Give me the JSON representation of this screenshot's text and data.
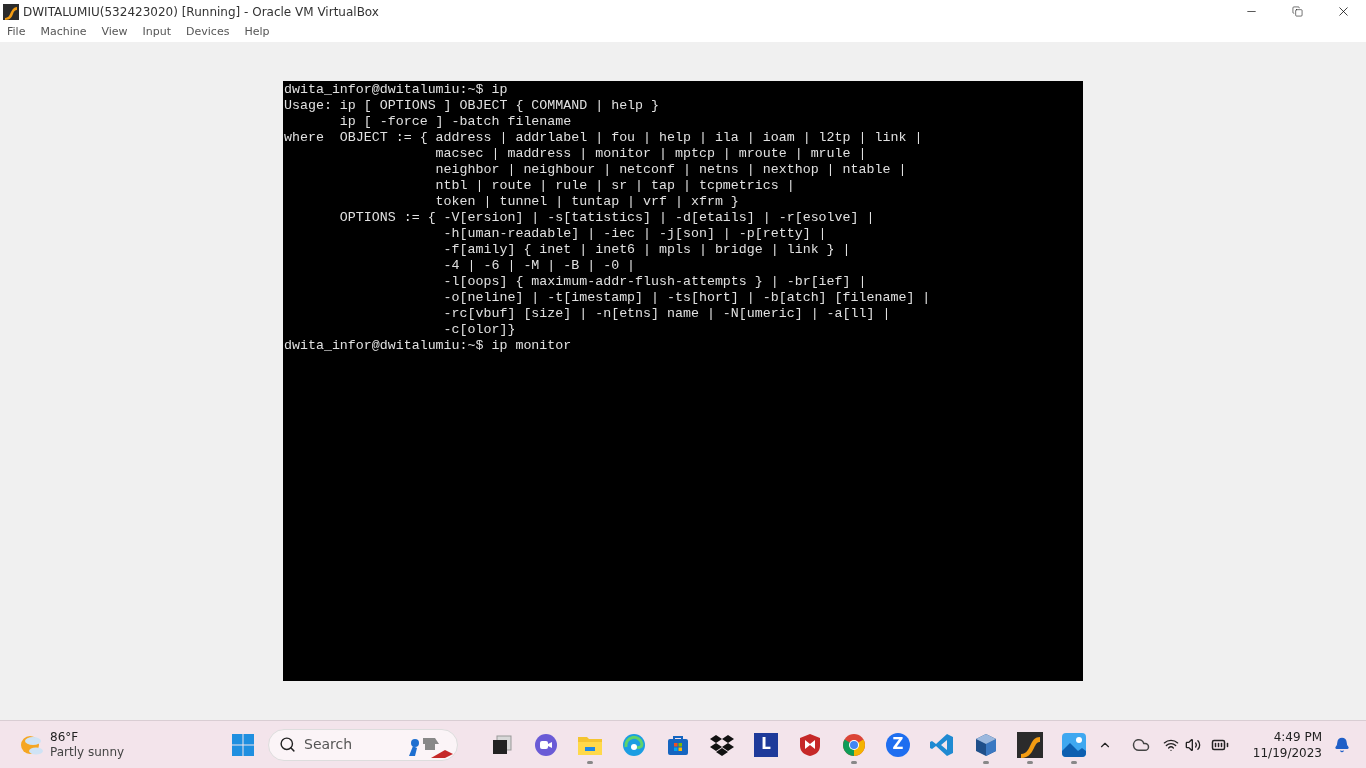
{
  "window": {
    "title": "DWITALUMIU(532423020) [Running] - Oracle VM VirtualBox"
  },
  "menu": [
    "File",
    "Machine",
    "View",
    "Input",
    "Devices",
    "Help"
  ],
  "terminal": {
    "lines": [
      "dwita_infor@dwitalumiu:~$ ip",
      "Usage: ip [ OPTIONS ] OBJECT { COMMAND | help }",
      "       ip [ -force ] -batch filename",
      "where  OBJECT := { address | addrlabel | fou | help | ila | ioam | l2tp | link |",
      "                   macsec | maddress | monitor | mptcp | mroute | mrule |",
      "                   neighbor | neighbour | netconf | netns | nexthop | ntable |",
      "                   ntbl | route | rule | sr | tap | tcpmetrics |",
      "                   token | tunnel | tuntap | vrf | xfrm }",
      "       OPTIONS := { -V[ersion] | -s[tatistics] | -d[etails] | -r[esolve] |",
      "                    -h[uman-readable] | -iec | -j[son] | -p[retty] |",
      "                    -f[amily] { inet | inet6 | mpls | bridge | link } |",
      "                    -4 | -6 | -M | -B | -0 |",
      "                    -l[oops] { maximum-addr-flush-attempts } | -br[ief] |",
      "                    -o[neline] | -t[imestamp] | -ts[hort] | -b[atch] [filename] |",
      "                    -rc[vbuf] [size] | -n[etns] name | -N[umeric] | -a[ll] |",
      "                    -c[olor]}",
      "dwita_infor@dwitalumiu:~$ ip monitor"
    ]
  },
  "taskbar": {
    "weather": {
      "temp": "86°F",
      "condition": "Partly sunny"
    },
    "search": {
      "placeholder": "Search"
    },
    "apps": [
      {
        "kind": "taskview",
        "running": false
      },
      {
        "kind": "meet",
        "running": false
      },
      {
        "kind": "folder",
        "running": true
      },
      {
        "kind": "edge",
        "running": false
      },
      {
        "kind": "store",
        "running": false
      },
      {
        "kind": "dropbox",
        "running": false
      },
      {
        "kind": "letter",
        "glyph": "L",
        "running": false
      },
      {
        "kind": "shield",
        "running": false
      },
      {
        "kind": "chrome",
        "running": true
      },
      {
        "kind": "letter-round",
        "glyph": "Z",
        "running": false
      },
      {
        "kind": "code",
        "running": false
      },
      {
        "kind": "cube",
        "running": true
      },
      {
        "kind": "vm",
        "running": true
      },
      {
        "kind": "photos",
        "running": true
      }
    ],
    "clock": {
      "time": "4:49 PM",
      "date": "11/19/2023"
    }
  }
}
